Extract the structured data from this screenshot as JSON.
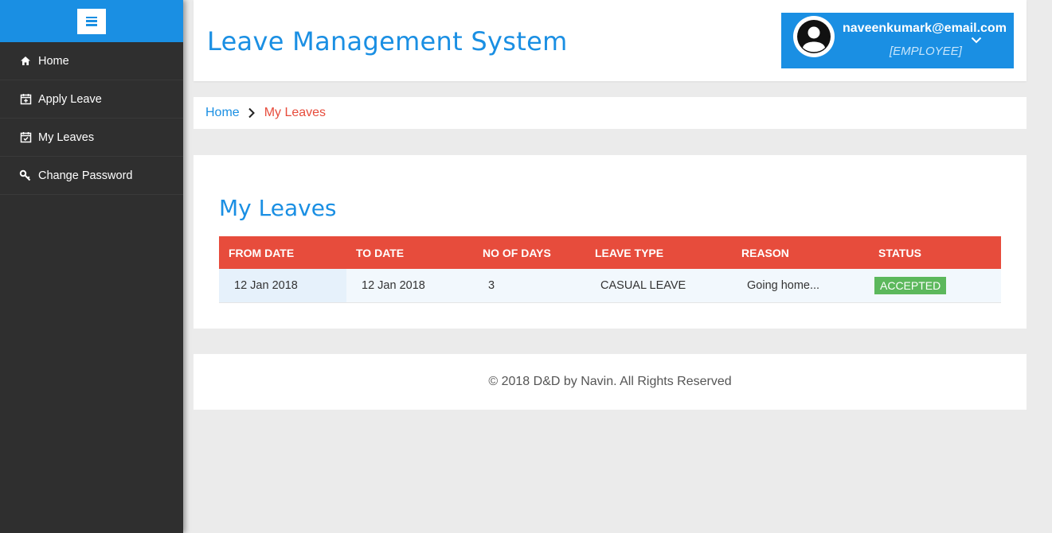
{
  "colors": {
    "accent": "#1a8fe3",
    "sidebar": "#2f2f2f",
    "table_header": "#e74c3c",
    "status_accepted": "#5cb85c"
  },
  "sidebar": {
    "toggle_icon": "hamburger-icon",
    "items": [
      {
        "label": "Home",
        "icon": "home-icon"
      },
      {
        "label": "Apply Leave",
        "icon": "calendar-plus-icon"
      },
      {
        "label": "My Leaves",
        "icon": "calendar-check-icon"
      },
      {
        "label": "Change Password",
        "icon": "key-icon"
      }
    ]
  },
  "header": {
    "title": "Leave Management System",
    "user": {
      "email": "naveenkumark@email.com",
      "role": "[EMPLOYEE]",
      "avatar_icon": "user-avatar-icon",
      "dropdown_icon": "chevron-down-icon"
    }
  },
  "breadcrumb": {
    "home": "Home",
    "current": "My Leaves"
  },
  "main": {
    "title": "My Leaves",
    "table": {
      "headers": [
        "FROM DATE",
        "TO DATE",
        "NO OF DAYS",
        "LEAVE TYPE",
        "REASON",
        "STATUS"
      ],
      "rows": [
        {
          "from": "12 Jan 2018",
          "to": "12 Jan 2018",
          "days": "3",
          "type": "CASUAL LEAVE",
          "reason": "Going home...",
          "status": "ACCEPTED"
        }
      ]
    }
  },
  "footer": {
    "text": "© 2018 D&D by Navin. All Rights Reserved"
  }
}
